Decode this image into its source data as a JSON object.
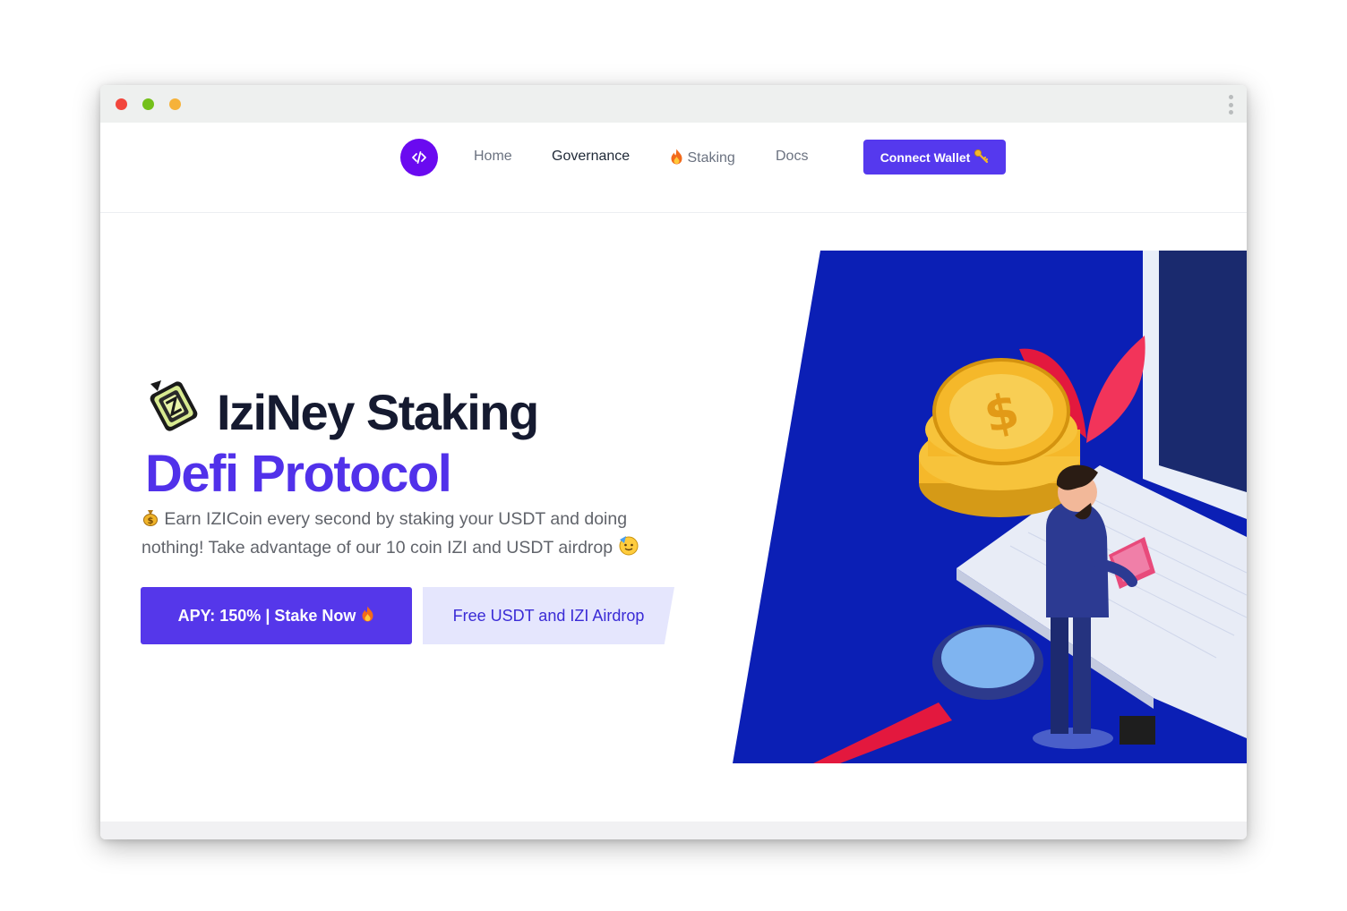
{
  "window": {
    "controls": [
      "close",
      "minimize",
      "maximize"
    ]
  },
  "nav": {
    "logo_icon": "code-logo-icon",
    "links": [
      {
        "label": "Home",
        "icon": ""
      },
      {
        "label": "Governance",
        "icon": ""
      },
      {
        "label": "Staking",
        "icon": "fire-icon"
      },
      {
        "label": "Docs",
        "icon": ""
      }
    ],
    "connect_label": "Connect Wallet",
    "connect_icon": "key-icon"
  },
  "hero": {
    "title_line1": "IziNey Staking",
    "title_line2": "Defi Protocol",
    "title_icon": "izi-coin-logo-icon",
    "subtitle": "Earn IZICoin every second by staking your USDT and doing nothing! Take advantage of our 10 coin IZI and USDT airdrop",
    "subtitle_icon_start": "money-bag-icon",
    "subtitle_icon_end": "partying-face-icon",
    "primary_button": "APY: 150% | Stake Now",
    "primary_icon": "fire-icon",
    "secondary_button": "Free USDT and IZI Airdrop"
  },
  "colors": {
    "brand": "#5539ee",
    "title_dark": "#151a30",
    "title_purple": "#5131ea",
    "illustration_bg": "#0b1fb5"
  }
}
